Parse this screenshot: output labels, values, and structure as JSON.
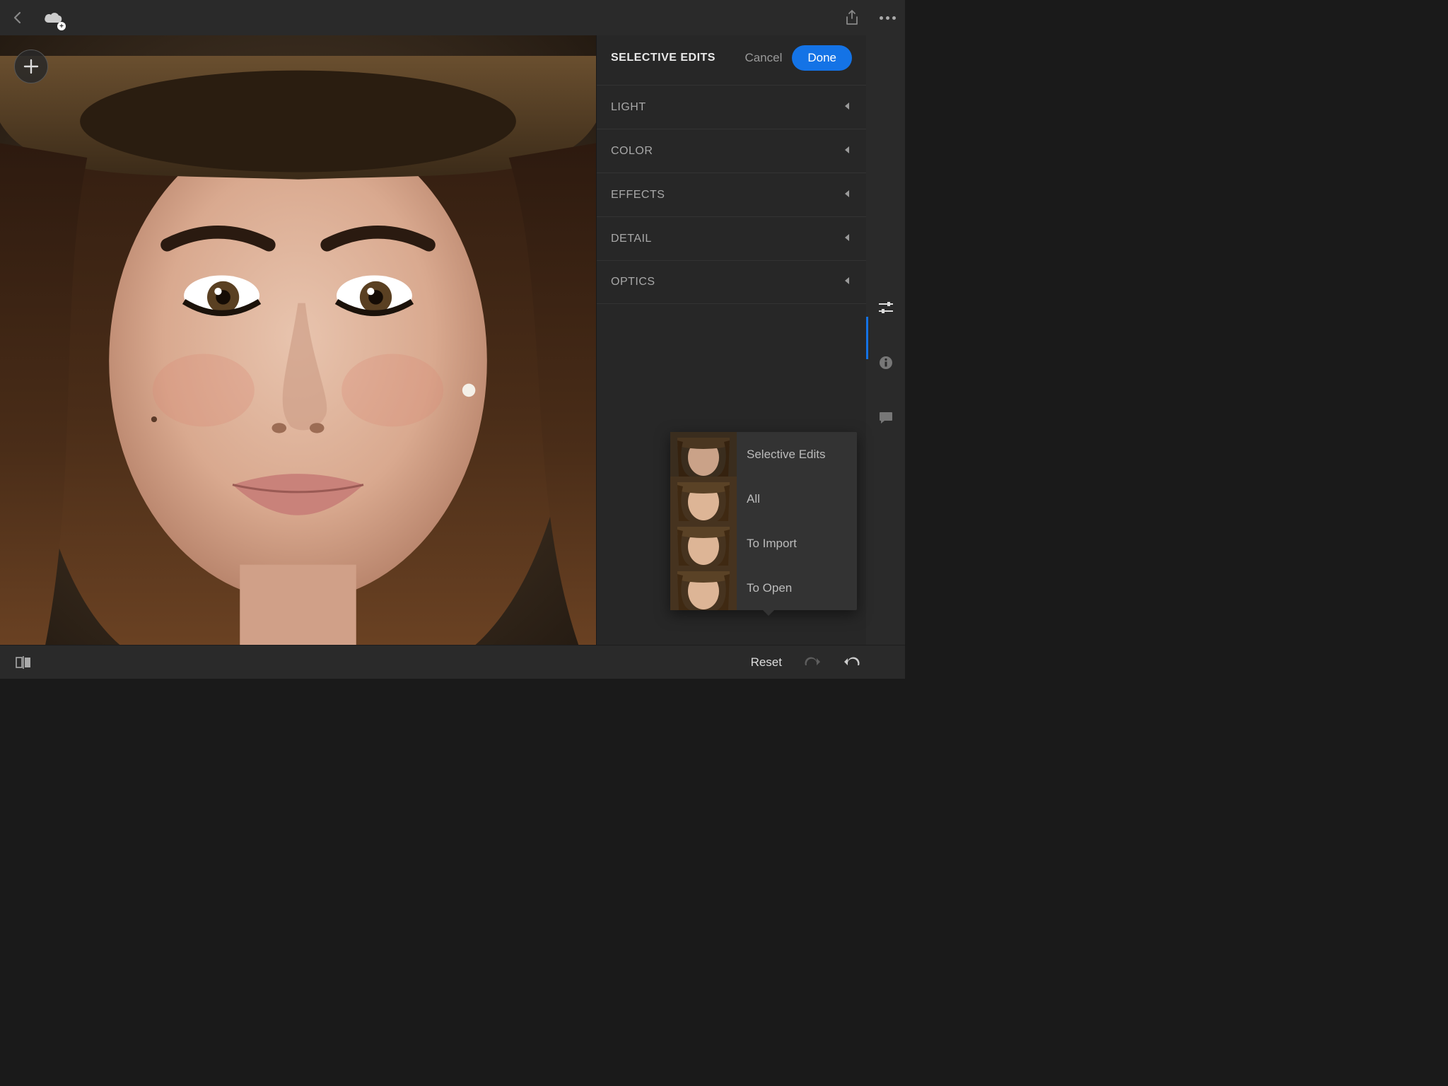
{
  "header": {
    "selective_title": "SELECTIVE EDITS",
    "cancel": "Cancel",
    "done": "Done"
  },
  "sections": [
    {
      "label": "LIGHT"
    },
    {
      "label": "COLOR"
    },
    {
      "label": "EFFECTS"
    },
    {
      "label": "DETAIL"
    },
    {
      "label": "OPTICS"
    }
  ],
  "popup": {
    "items": [
      {
        "label": "Selective Edits"
      },
      {
        "label": "All"
      },
      {
        "label": "To Import"
      },
      {
        "label": "To Open"
      }
    ]
  },
  "bottom": {
    "reset": "Reset"
  }
}
